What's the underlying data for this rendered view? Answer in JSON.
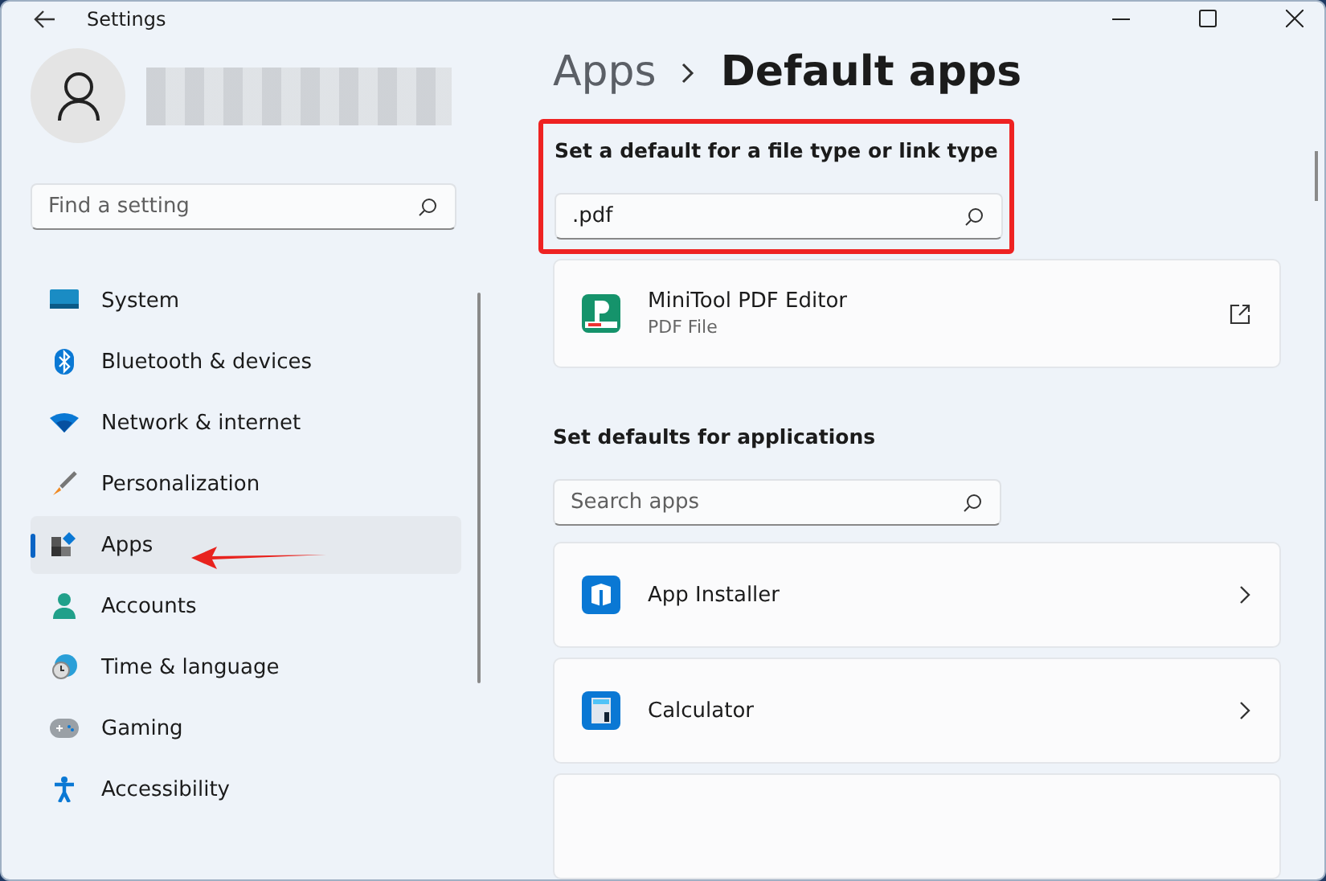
{
  "window": {
    "title": "Settings"
  },
  "search": {
    "placeholder": "Find a setting"
  },
  "sidebar": {
    "items": [
      {
        "label": "System",
        "selected": false
      },
      {
        "label": "Bluetooth & devices",
        "selected": false
      },
      {
        "label": "Network & internet",
        "selected": false
      },
      {
        "label": "Personalization",
        "selected": false
      },
      {
        "label": "Apps",
        "selected": true
      },
      {
        "label": "Accounts",
        "selected": false
      },
      {
        "label": "Time & language",
        "selected": false
      },
      {
        "label": "Gaming",
        "selected": false
      },
      {
        "label": "Accessibility",
        "selected": false
      }
    ]
  },
  "breadcrumb": [
    "Apps",
    "Default apps"
  ],
  "file_type_section": {
    "heading": "Set a default for a file type or link type",
    "value": ".pdf",
    "result": {
      "name": "MiniTool PDF Editor",
      "subtitle": "PDF File"
    }
  },
  "applications": {
    "heading": "Set defaults for applications",
    "placeholder": "Search apps",
    "apps": [
      {
        "name": "App Installer"
      },
      {
        "name": "Calculator"
      }
    ]
  }
}
